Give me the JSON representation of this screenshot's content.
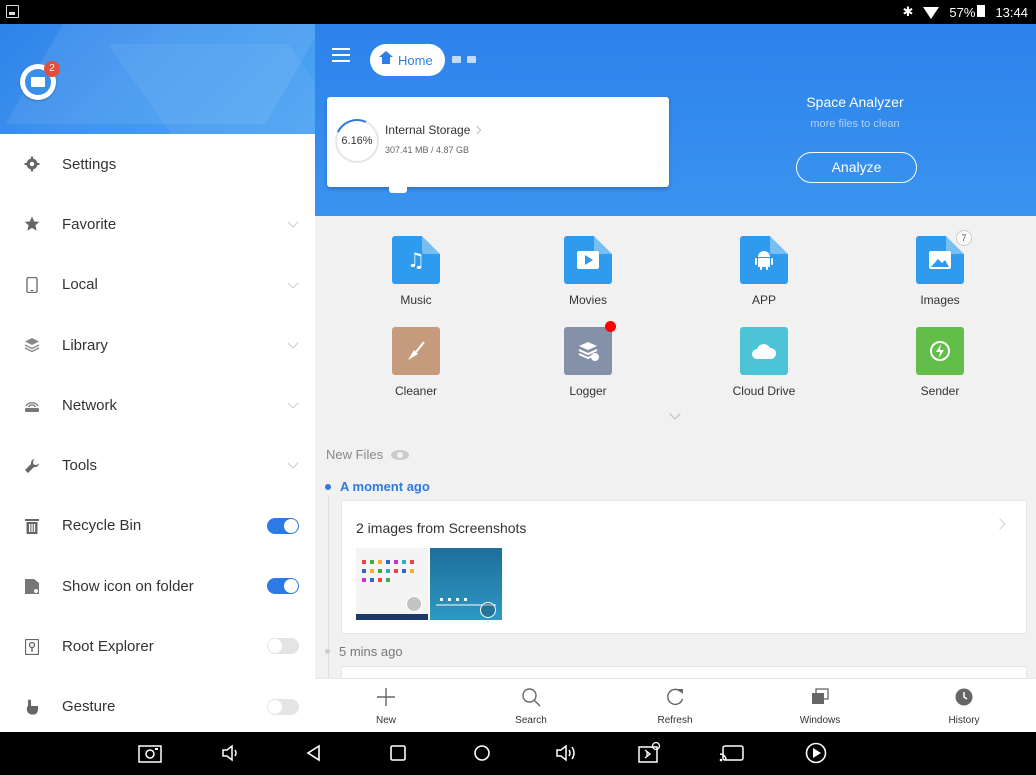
{
  "status_bar": {
    "battery": "57%",
    "time": "13:44"
  },
  "drawer": {
    "mail_badge": "2",
    "items": [
      {
        "label": "Settings"
      },
      {
        "label": "Favorite"
      },
      {
        "label": "Local"
      },
      {
        "label": "Library"
      },
      {
        "label": "Network"
      },
      {
        "label": "Tools"
      },
      {
        "label": "Recycle Bin",
        "toggle": "on"
      },
      {
        "label": "Show icon on folder",
        "toggle": "on"
      },
      {
        "label": "Root Explorer",
        "toggle": "off"
      },
      {
        "label": "Gesture",
        "toggle": "off"
      }
    ]
  },
  "header": {
    "breadcrumb_home": "Home",
    "storage": {
      "percent": "6.16%",
      "title": "Internal Storage",
      "usage": "307.41 MB / 4.87 GB"
    },
    "analyzer": {
      "title": "Space Analyzer",
      "subtitle": "more files to clean",
      "button": "Analyze"
    }
  },
  "categories": [
    {
      "label": "Music",
      "color": "#2f9bee",
      "icon": "music-note-icon",
      "glyph": "♫"
    },
    {
      "label": "Movies",
      "color": "#2f9bee",
      "icon": "play-icon",
      "glyph": "▶"
    },
    {
      "label": "APP",
      "color": "#2f9bee",
      "icon": "android-icon",
      "glyph": "🤖"
    },
    {
      "label": "Images",
      "color": "#2f9bee",
      "icon": "image-icon",
      "glyph": "▲",
      "badge": "7"
    },
    {
      "label": "Cleaner",
      "color": "#c89c7b",
      "icon": "broom-icon",
      "glyph": "✦"
    },
    {
      "label": "Logger",
      "color": "#8792a8",
      "icon": "logger-icon",
      "glyph": "≋",
      "dot": true
    },
    {
      "label": "Cloud Drive",
      "color": "#4dc6d8",
      "icon": "cloud-icon",
      "glyph": "☁"
    },
    {
      "label": "Sender",
      "color": "#64c04a",
      "icon": "sender-icon",
      "glyph": "↻"
    }
  ],
  "new_files": {
    "title": "New Files",
    "groups": [
      {
        "time": "A moment ago",
        "card_title": "2 images from Screenshots"
      },
      {
        "time": "5 mins ago"
      }
    ]
  },
  "bottom_bar": [
    {
      "label": "New",
      "icon": "plus-icon"
    },
    {
      "label": "Search",
      "icon": "search-icon"
    },
    {
      "label": "Refresh",
      "icon": "refresh-icon"
    },
    {
      "label": "Windows",
      "icon": "windows-icon"
    },
    {
      "label": "History",
      "icon": "history-icon"
    }
  ],
  "colors": {
    "accent": "#2b7ae6",
    "header": "#3a93f0"
  }
}
